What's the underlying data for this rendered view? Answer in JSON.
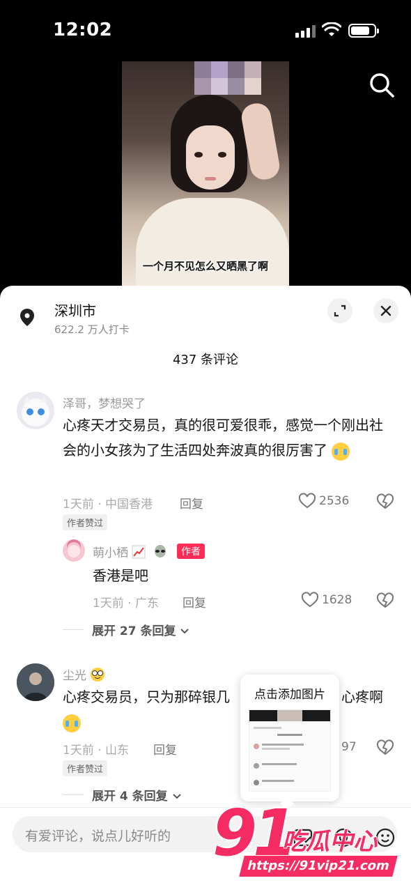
{
  "status_bar": {
    "time": "12:02"
  },
  "video": {
    "subtitle": "一个月不见怎么又晒黑了啊"
  },
  "location": {
    "name": "深圳市",
    "checkins": "622.2 万人打卡"
  },
  "comments_header": {
    "count_text": "437 条评论"
  },
  "comments": [
    {
      "author": "泽哥，梦想哭了",
      "text": "心疼天才交易员，真的很可爱很乖，感觉一个刚出社会的小女孩为了生活四处奔波真的很厉害了",
      "meta": "1天前 · 中国香港",
      "reply_label": "回复",
      "likes": "2536",
      "author_liked": "作者赞过",
      "reply": {
        "author": "萌小栖",
        "badge": "作者",
        "text": "香港是吧",
        "meta": "1天前 · 广东",
        "reply_label": "回复",
        "likes": "1628"
      },
      "expand_label": "展开 27 条回复"
    },
    {
      "author": "尘光",
      "text": "心疼交易员，只为那碎银几",
      "text_tail": "心疼啊",
      "meta": "1天前 · 山东",
      "reply_label": "回复",
      "likes": "97",
      "author_liked": "作者赞过",
      "expand_label": "展开 4 条回复"
    }
  ],
  "popup": {
    "title": "点击添加图片"
  },
  "input": {
    "placeholder": "有爱评论，说点儿好听的"
  },
  "watermark": {
    "number": "91",
    "brand": "吃瓜中心",
    "url": "https://91vip21.com"
  },
  "colors": {
    "accent": "#fe2c55",
    "watermark": "#f52b63"
  }
}
